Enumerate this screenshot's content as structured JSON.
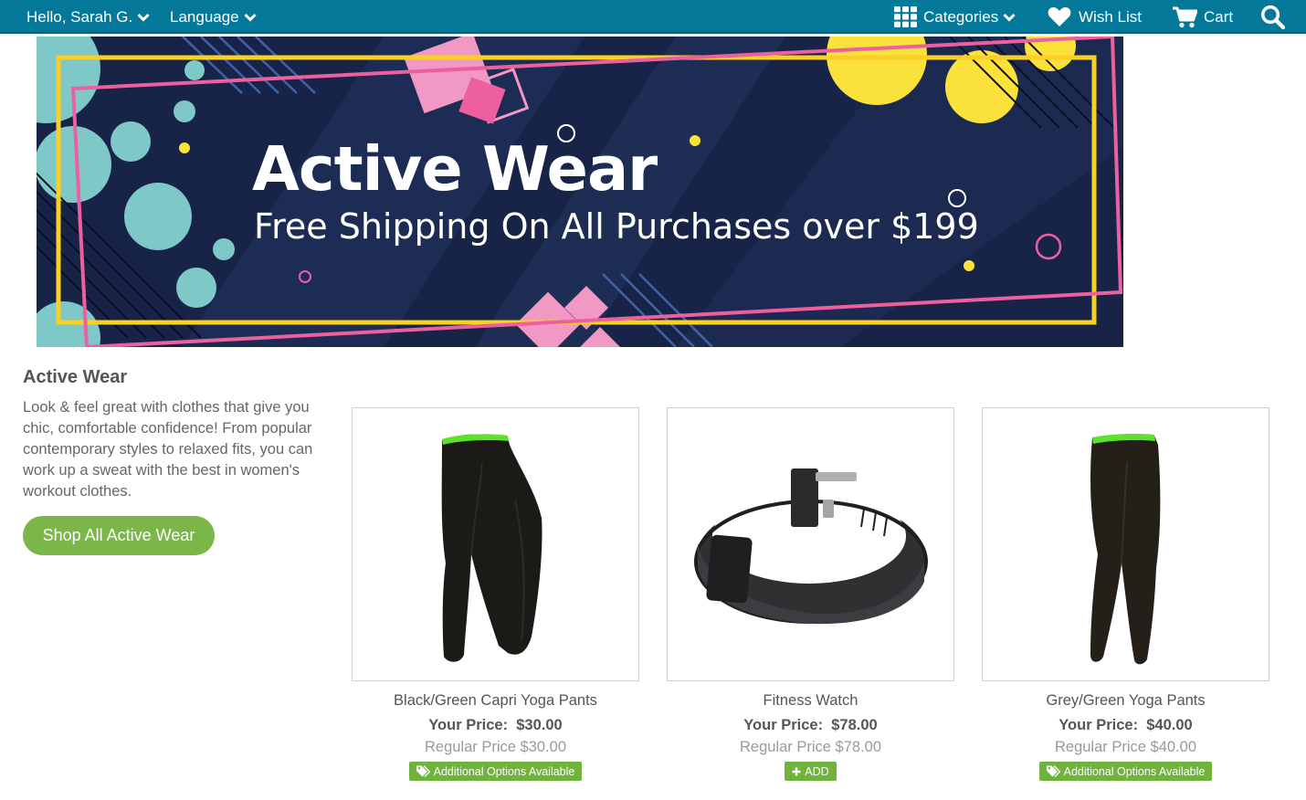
{
  "nav": {
    "greeting": "Hello, Sarah G.",
    "language": "Language",
    "categories": "Categories",
    "wishlist": "Wish List",
    "cart": "Cart",
    "icons": [
      "chevron-down-icon",
      "grid-icon",
      "heart-icon",
      "cart-icon",
      "search-icon"
    ]
  },
  "banner": {
    "title": "Active Wear",
    "subtitle": "Free Shipping On All Purchases over $199"
  },
  "intro": {
    "title": "Active Wear",
    "description": "Look & feel great with clothes that give you chic, comfortable confidence! From popular contemporary styles to relaxed fits, you can work up a sweat with the best in women's workout clothes.",
    "button": "Shop All Active Wear"
  },
  "products": [
    {
      "name": "Black/Green Capri Yoga Pants",
      "price_label": "Your Price:",
      "price": "$30.00",
      "regular": "Regular Price $30.00",
      "badge": "Additional Options Available",
      "badge_icon": "tags-icon"
    },
    {
      "name": "Fitness Watch",
      "price_label": "Your Price:",
      "price": "$78.00",
      "regular": "Regular Price $78.00",
      "badge": "ADD",
      "badge_icon": "plus-icon"
    },
    {
      "name": "Grey/Green Yoga Pants",
      "price_label": "Your Price:",
      "price": "$40.00",
      "regular": "Regular Price $40.00",
      "badge": "Additional Options Available",
      "badge_icon": "tags-icon"
    }
  ],
  "colors": {
    "nav_bg": "#037899",
    "banner_bg": "#172447",
    "accent_green": "#7ab648",
    "badge_green": "#6fb33c",
    "banner_yellow": "#fbd024",
    "banner_pink": "#ee5fa0",
    "banner_teal": "#7ec9c8"
  }
}
